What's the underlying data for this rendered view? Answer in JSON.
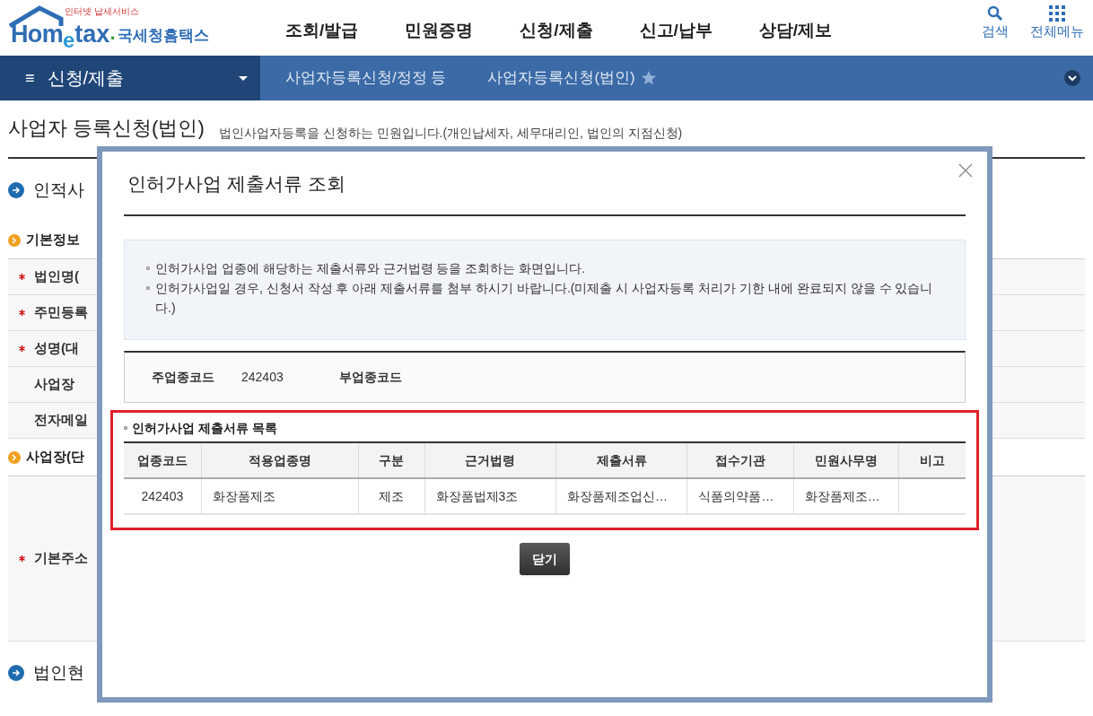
{
  "header": {
    "logo_text": "Hom",
    "logo_e": "e",
    "logo_tax": "tax",
    "logo_dot": ".",
    "logo_korean": "국세청홈택스",
    "logo_tagline": "인터넷 납세서비스",
    "menu": [
      "조회/발급",
      "민원증명",
      "신청/제출",
      "신고/납부",
      "상담/제보"
    ],
    "search_label": "검색",
    "all_menu_label": "전체메뉴"
  },
  "breadcrumb": {
    "menu_icon": "≡",
    "current": "신청/제출",
    "items": [
      "사업자등록신청/정정 등",
      "사업자등록신청(법인)"
    ],
    "favorite": false
  },
  "page": {
    "title": "사업자 등록신청(법인)",
    "description": "법인사업자등록을 신청하는 민원입니다.(개인납세자, 세무대리인, 법인의 지점신청)",
    "sections": [
      {
        "kind": "major",
        "label": "인적사"
      },
      {
        "kind": "minor",
        "label": "기본정보"
      },
      {
        "kind": "row",
        "label": "법인명(",
        "required": true
      },
      {
        "kind": "row",
        "label": "주민등록",
        "required": true
      },
      {
        "kind": "row",
        "label": "성명(대",
        "required": true
      },
      {
        "kind": "row",
        "label": "사업장",
        "required": false
      },
      {
        "kind": "row",
        "label": "전자메일",
        "required": false
      },
      {
        "kind": "minor",
        "label": "사업장(단"
      },
      {
        "kind": "tall",
        "label": "기본주소",
        "required": true
      },
      {
        "kind": "major",
        "label": "법인현"
      }
    ]
  },
  "dialog": {
    "title": "인허가사업 제출서류 조회",
    "notes": [
      "인허가사업 업종에 해당하는 제출서류와 근거법령 등을 조회하는 화면입니다.",
      "인허가사업일 경우, 신청서 작성 후 아래 제출서류를 첨부 하시기 바랍니다.(미제출 시 사업자등록 처리가 기한 내에 완료되지 않을 수 있습니다.)"
    ],
    "codes": [
      {
        "label": "주업종코드",
        "value": "242403"
      },
      {
        "label": "부업종코드"
      }
    ],
    "list_title": "인허가사업 제출서류 목록",
    "table": {
      "columns": [
        "업종코드",
        "적용업종명",
        "구분",
        "근거법령",
        "제출서류",
        "접수기관",
        "민원사무명",
        "비고"
      ],
      "rows": [
        [
          "242403",
          "화장품제조",
          "제조",
          "화장품법제3조",
          "화장품제조업신…",
          "식품의약품…",
          "화장품제조…",
          ""
        ]
      ]
    },
    "close_button": "닫기"
  }
}
